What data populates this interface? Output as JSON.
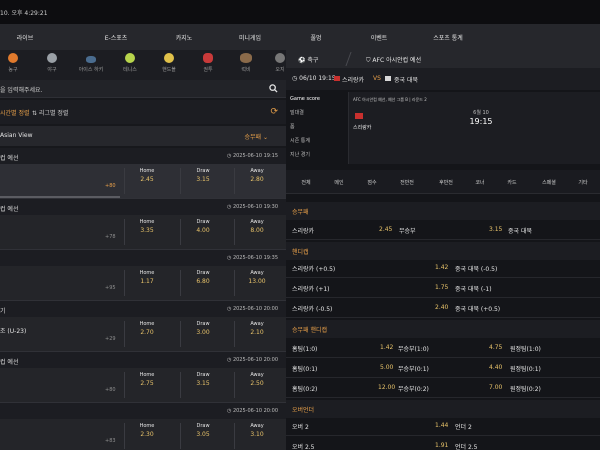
{
  "clock": "10. 오후 4:29:21",
  "nav": [
    "라이브",
    "E-스포츠",
    "카지노",
    "미니게임",
    "풀멍",
    "이벤트",
    "스포츠 통계"
  ],
  "sports": [
    {
      "label": "농구",
      "color": "#e07a2d"
    },
    {
      "label": "야구",
      "color": "#9aa0a6"
    },
    {
      "label": "아이스 하키",
      "color": "#4a6c8f"
    },
    {
      "label": "테니스",
      "color": "#b7d44c"
    },
    {
      "label": "핸드볼",
      "color": "#e0c14a"
    },
    {
      "label": "권투",
      "color": "#c83a3a"
    },
    {
      "label": "럭비",
      "color": "#8a6a4a"
    },
    {
      "label": "오지",
      "color": "#777777"
    }
  ],
  "search": {
    "text": "을 입력해주세요."
  },
  "filters": {
    "time": "시간별 정렬",
    "league": "리그별 정렬"
  },
  "asian_view": {
    "title": "Asian View",
    "select": "승무패"
  },
  "matches": [
    {
      "league": "컵 예선",
      "date": "2025-06-10 19:15",
      "home": "2.45",
      "draw": "3.15",
      "away": "2.80",
      "more": "+80",
      "active": true
    },
    {
      "league": "컵 예선",
      "date": "2025-06-10 19:30",
      "home": "3.35",
      "draw": "4.00",
      "away": "8.00",
      "more": "+78",
      "active": false
    },
    {
      "league": "",
      "date": "2025-06-10 19:35",
      "home": "1.17",
      "draw": "6.80",
      "away": "13.00",
      "more": "+95",
      "active": false
    },
    {
      "league": "기",
      "date": "2025-06-10 20:00",
      "home": "2.70",
      "draw": "3.00",
      "away": "2.10",
      "more": "+29",
      "active": false,
      "team": "조 (U-23)"
    },
    {
      "league": "컵 예선",
      "date": "2025-06-10 20:00",
      "home": "2.75",
      "draw": "3.15",
      "away": "2.50",
      "more": "+80",
      "active": false
    },
    {
      "league": "",
      "date": "2025-06-10 20:00",
      "home": "2.30",
      "draw": "3.05",
      "away": "3.10",
      "more": "+83",
      "active": false
    }
  ],
  "odds_labels": {
    "home": "Home",
    "draw": "Draw",
    "away": "Away"
  },
  "right": {
    "tab_sport": "축구",
    "tab_league": "AFC 아시안컵 예선",
    "match_time": "06/10 19:15",
    "team_a": "스리랑카",
    "vs": "VS",
    "team_b": "중국 대북",
    "menu": [
      "Game score",
      "빌대결",
      "폼",
      "시즌 통계",
      "지난 경기"
    ],
    "card_league": "AFC 아시안컵 예선, 예선 그룹 B | 라운드 2",
    "card_date": "6월 10",
    "card_time": "19:15",
    "card_team": "스리랑카",
    "market_tabs": [
      "전체",
      "메인",
      "점수",
      "전반전",
      "후반전",
      "코너",
      "카드",
      "스페셜",
      "기타"
    ],
    "sections": {
      "s1": "승무패",
      "s2": "핸디캡",
      "s3": "승무패 핸디캡",
      "s4": "오버언더"
    },
    "wdl": {
      "home": "스리랑카",
      "home_odd": "2.45",
      "draw": "무승부",
      "draw_odd": "3.15",
      "away": "중국 대북"
    },
    "handicap": [
      {
        "home": "스리랑카 (+0.5)",
        "odd": "1.42",
        "away": "중국 대북 (-0.5)"
      },
      {
        "home": "스리랑카 (+1)",
        "odd": "1.75",
        "away": "중국 대북 (-1)"
      },
      {
        "home": "스리랑카 (-0.5)",
        "odd": "2.40",
        "away": "중국 대북 (+0.5)"
      }
    ],
    "wdl_handicap": [
      {
        "a": "홈팀(1:0)",
        "a_odd": "1.42",
        "b": "무승부(1:0)",
        "c_odd": "4.75",
        "c": "원정팀(1:0)"
      },
      {
        "a": "홈팀(0:1)",
        "a_odd": "5.00",
        "b": "무승부(0:1)",
        "c_odd": "4.40",
        "c": "원정팀(0:1)"
      },
      {
        "a": "홈팀(0:2)",
        "a_odd": "12.00",
        "b": "무승부(0:2)",
        "c_odd": "7.00",
        "c": "원정팀(0:2)"
      }
    ],
    "overunder": [
      {
        "a": "오버 2",
        "a_odd": "1.44",
        "b": "언더 2"
      },
      {
        "a": "오버 2.5",
        "a_odd": "1.91",
        "b": "언더 2.5"
      }
    ]
  }
}
